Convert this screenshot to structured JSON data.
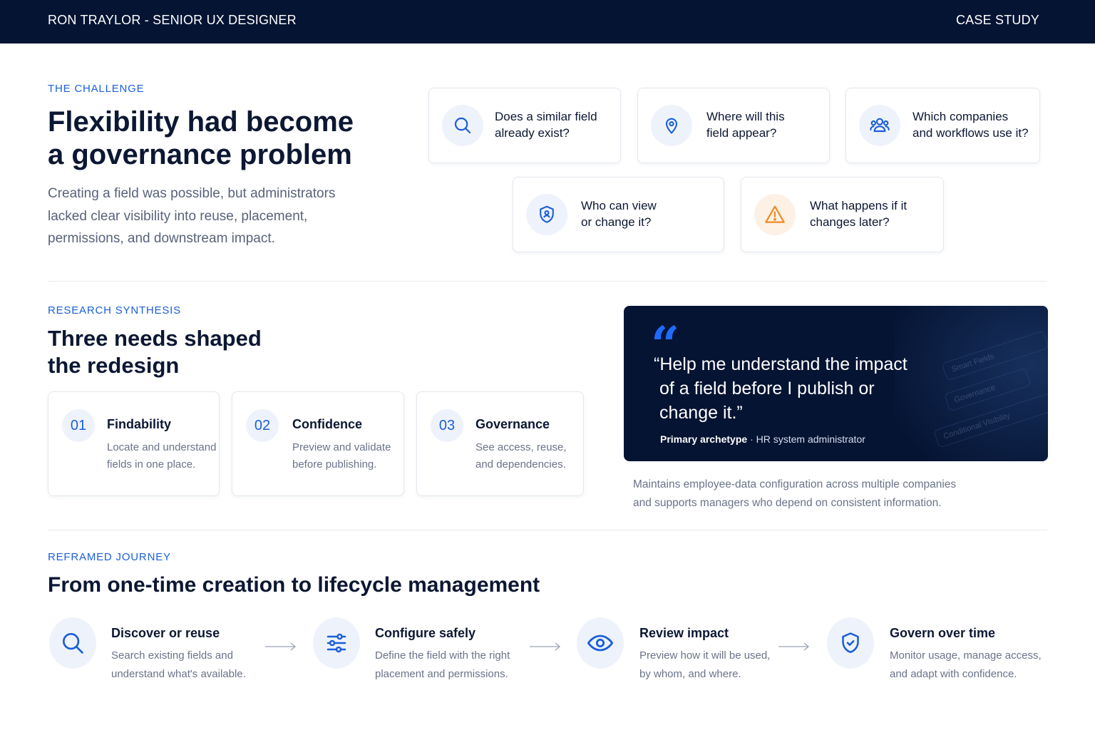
{
  "header": {
    "left": "RON TRAYLOR - SENIOR UX DESIGNER",
    "right": "CASE STUDY"
  },
  "challenge": {
    "eyebrow": "THE CHALLENGE",
    "title_line1": "Flexibility had become",
    "title_line2": "a governance problem",
    "desc_line1": "Creating a field was possible, but administrators",
    "desc_line2": "lacked clear visibility into reuse, placement,",
    "desc_line3": "permissions, and downstream impact.",
    "questions": [
      {
        "icon": "search-icon",
        "line1": "Does a similar field",
        "line2": "already exist?"
      },
      {
        "icon": "location-pin-icon",
        "line1": "Where will this",
        "line2": "field appear?"
      },
      {
        "icon": "users-icon",
        "line1": "Which companies",
        "line2": "and workflows use it?"
      },
      {
        "icon": "shield-user-icon",
        "line1": "Who can view",
        "line2": "or change it?"
      },
      {
        "icon": "warning-icon",
        "line1": "What happens if it",
        "line2": "changes later?"
      }
    ]
  },
  "research": {
    "eyebrow": "RESEARCH SYNTHESIS",
    "title_line1": "Three needs shaped",
    "title_line2": "the redesign",
    "needs": [
      {
        "num": "01",
        "title": "Findability",
        "line1": "Locate and understand",
        "line2": "fields in one place."
      },
      {
        "num": "02",
        "title": "Confidence",
        "line1": "Preview and validate",
        "line2": "before publishing."
      },
      {
        "num": "03",
        "title": "Governance",
        "line1": "See access, reuse,",
        "line2": "and dependencies."
      }
    ],
    "quote": {
      "mark": "“",
      "line1": "“Help me understand the impact",
      "line2": "of a field before I publish or",
      "line3": "change it.”",
      "who_label": "Primary archetype",
      "who_sep": " · ",
      "who_role": "HR system administrator",
      "bg_labels": [
        "Smart Fields",
        "Governance",
        "Conditional Visibility"
      ]
    },
    "caption_line1": "Maintains employee-data configuration across multiple companies",
    "caption_line2": "and supports managers who depend on consistent information."
  },
  "journey": {
    "eyebrow": "REFRAMED JOURNEY",
    "title": "From one-time creation to lifecycle management",
    "steps": [
      {
        "icon": "search-icon",
        "title": "Discover or reuse",
        "line1": "Search existing fields and",
        "line2": "understand what's available."
      },
      {
        "icon": "sliders-icon",
        "title": "Configure safely",
        "line1": "Define the field with the right",
        "line2": "placement and permissions."
      },
      {
        "icon": "eye-icon",
        "title": "Review impact",
        "line1": "Preview how it will be used,",
        "line2": "by whom, and where."
      },
      {
        "icon": "shield-check-icon",
        "title": "Govern over time",
        "line1": "Monitor usage, manage access,",
        "line2": "and adapt with confidence."
      }
    ]
  },
  "colors": {
    "navy": "#051433",
    "accent": "#1b5fd9",
    "warning": "#f08a24"
  }
}
